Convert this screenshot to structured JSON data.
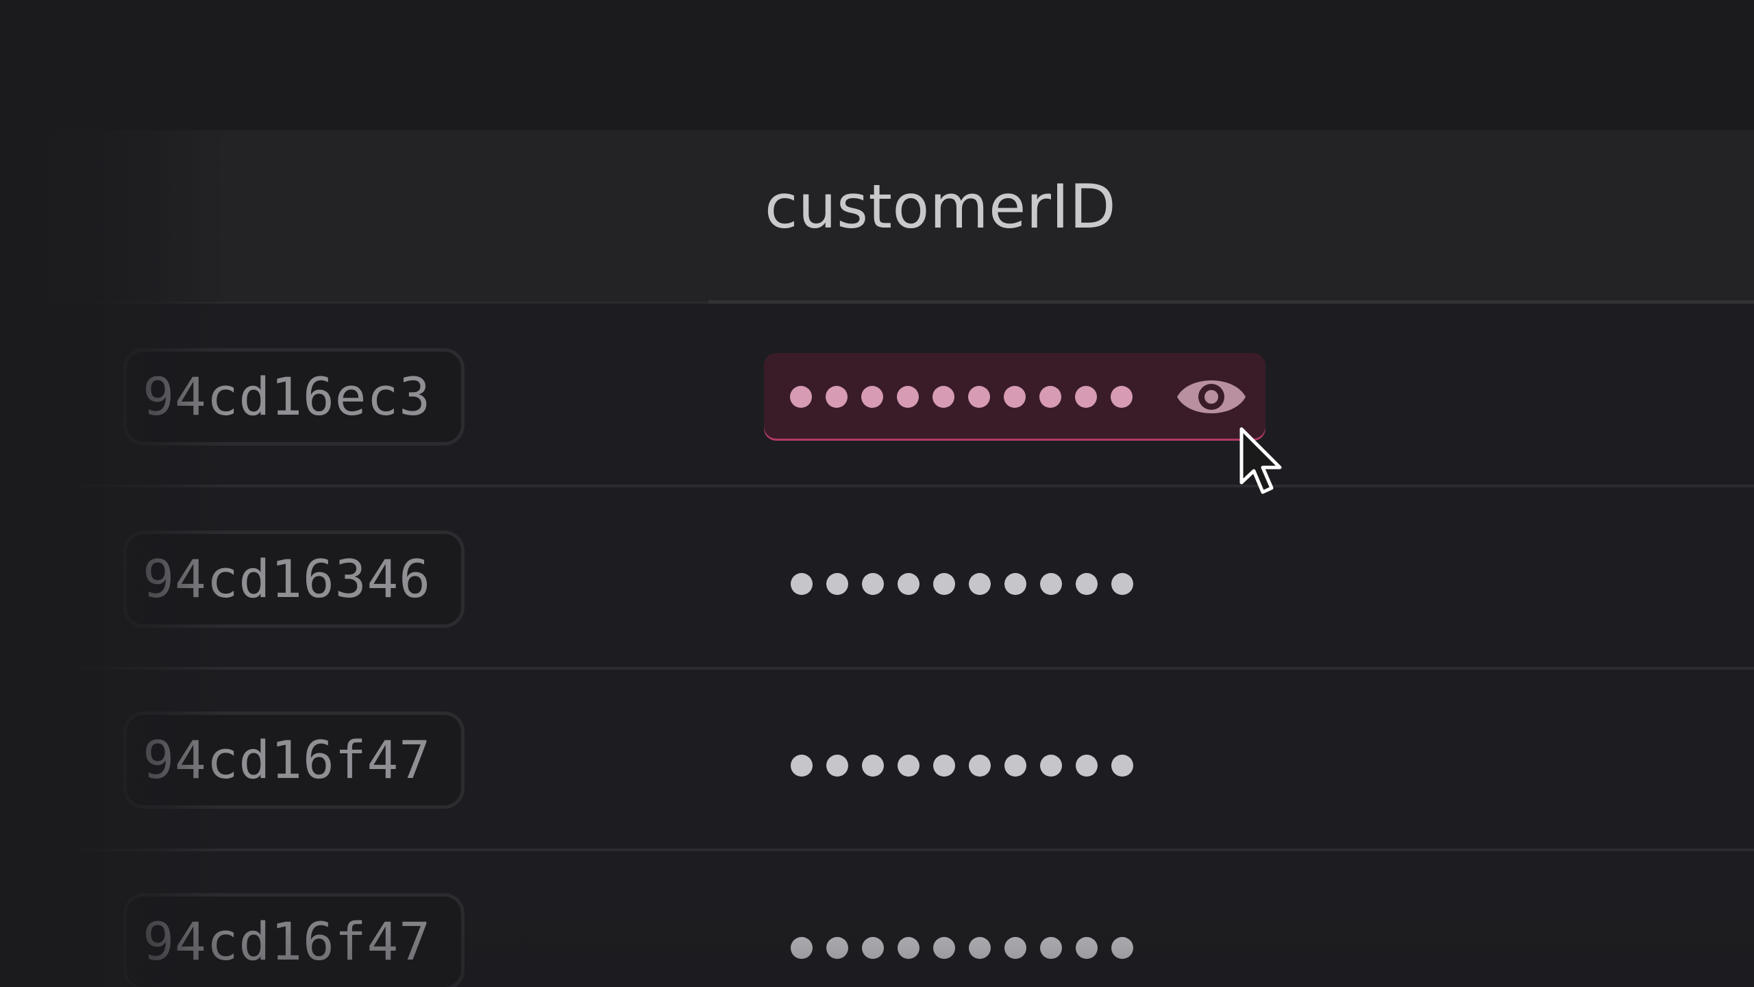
{
  "table": {
    "column_header": "customerID",
    "rows": [
      {
        "id": "94cd16ec3",
        "masked_value": "••••••••••",
        "revealable": true,
        "hovered": true
      },
      {
        "id": "94cd16346",
        "masked_value": "••••••••••",
        "revealable": false,
        "hovered": false
      },
      {
        "id": "94cd16f47",
        "masked_value": "••••••••••",
        "revealable": false,
        "hovered": false
      },
      {
        "id": "94cd16f47",
        "masked_value": "••••••••••",
        "revealable": false,
        "hovered": false
      }
    ]
  },
  "icons": {
    "reveal": "eye-icon",
    "pointer": "mouse-cursor-icon"
  },
  "colors": {
    "background": "#1b1b1e",
    "header_background": "#232326",
    "highlight_background": "#3a1c29",
    "highlight_border": "#b23a66",
    "highlight_dots": "#d79bb4",
    "dots": "#c6c6ca",
    "eye_icon": "#b8909f"
  }
}
